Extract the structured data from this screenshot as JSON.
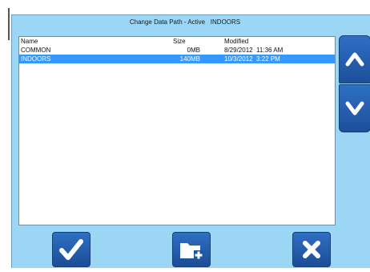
{
  "dialog": {
    "title": "Change Data Path - Active",
    "active_path": "INDOORS"
  },
  "list": {
    "columns": {
      "name": "Name",
      "size": "Size",
      "modified": "Modified"
    },
    "rows": [
      {
        "name": "COMMON",
        "size": "0MB",
        "date": "8/29/2012",
        "time": "11:36 AM",
        "selected": false
      },
      {
        "name": "INDOORS",
        "size": "140MB",
        "date": "10/3/2012",
        "time": "3:22 PM",
        "selected": true
      }
    ]
  },
  "icons": {
    "scroll_up": "chevron-up-icon",
    "scroll_down": "chevron-down-icon",
    "confirm": "checkmark-icon",
    "new_folder": "new-folder-icon",
    "cancel": "close-icon"
  },
  "colors": {
    "background": "#9bd6f4",
    "button": "#2f6fc4",
    "selection": "#3399ff"
  }
}
